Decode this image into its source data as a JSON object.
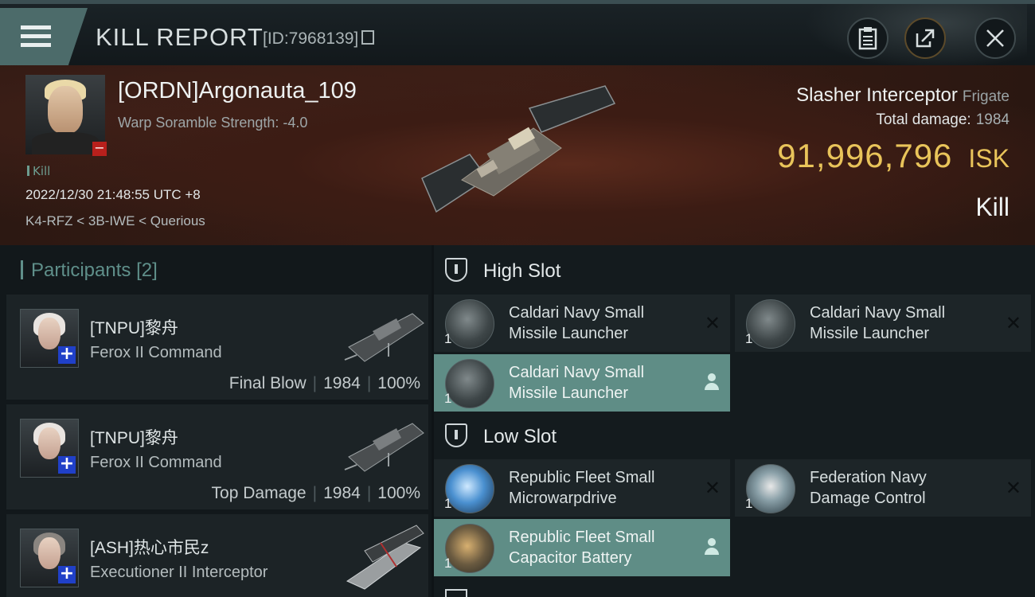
{
  "header": {
    "title": "KILL REPORT",
    "kill_id": "[ID:7968139]"
  },
  "victim": {
    "name": "[ORDN]Argonauta_109",
    "warp_scramble": "Warp Soramble Strength: -4.0",
    "kill_tag": "Kill",
    "timestamp": "2022/12/30 21:48:55 UTC +8",
    "location": "K4-RFZ < 3B-IWE < Querious",
    "ship_name": "Slasher Interceptor",
    "ship_class": "Frigate",
    "total_damage_label": "Total damage:",
    "total_damage": "1984",
    "isk_value": "91,996,796",
    "isk_unit": "ISK",
    "result": "Kill"
  },
  "participants": {
    "title": "Participants",
    "count": "[2]",
    "items": [
      {
        "name": "[TNPU]黎舟",
        "ship": "Ferox II Command",
        "stat_label": "Final Blow",
        "damage": "1984",
        "percent": "100%"
      },
      {
        "name": "[TNPU]黎舟",
        "ship": "Ferox II Command",
        "stat_label": "Top Damage",
        "damage": "1984",
        "percent": "100%"
      },
      {
        "name": "[ASH]热心市民z",
        "ship": "Executioner II Interceptor"
      }
    ]
  },
  "fitting": {
    "high_slot": {
      "title": "High Slot",
      "modules": [
        {
          "name": "Caldari Navy Small Missile Launcher",
          "qty": "1",
          "status": "destroyed"
        },
        {
          "name": "Caldari Navy Small Missile Launcher",
          "qty": "1",
          "status": "destroyed"
        },
        {
          "name": "Caldari Navy Small Missile Launcher",
          "qty": "1",
          "status": "dropped"
        }
      ]
    },
    "low_slot": {
      "title": "Low Slot",
      "modules": [
        {
          "name": "Republic Fleet Small Microwarpdrive",
          "qty": "1",
          "status": "destroyed"
        },
        {
          "name": "Federation Navy Damage Control",
          "qty": "1",
          "status": "destroyed"
        },
        {
          "name": "Republic Fleet Small Capacitor Battery",
          "qty": "1",
          "status": "dropped"
        }
      ]
    }
  },
  "colors": {
    "accent": "#5f8d86",
    "isk": "#e9c45a",
    "badge_red": "#b8201c",
    "badge_blue": "#2040c8"
  }
}
